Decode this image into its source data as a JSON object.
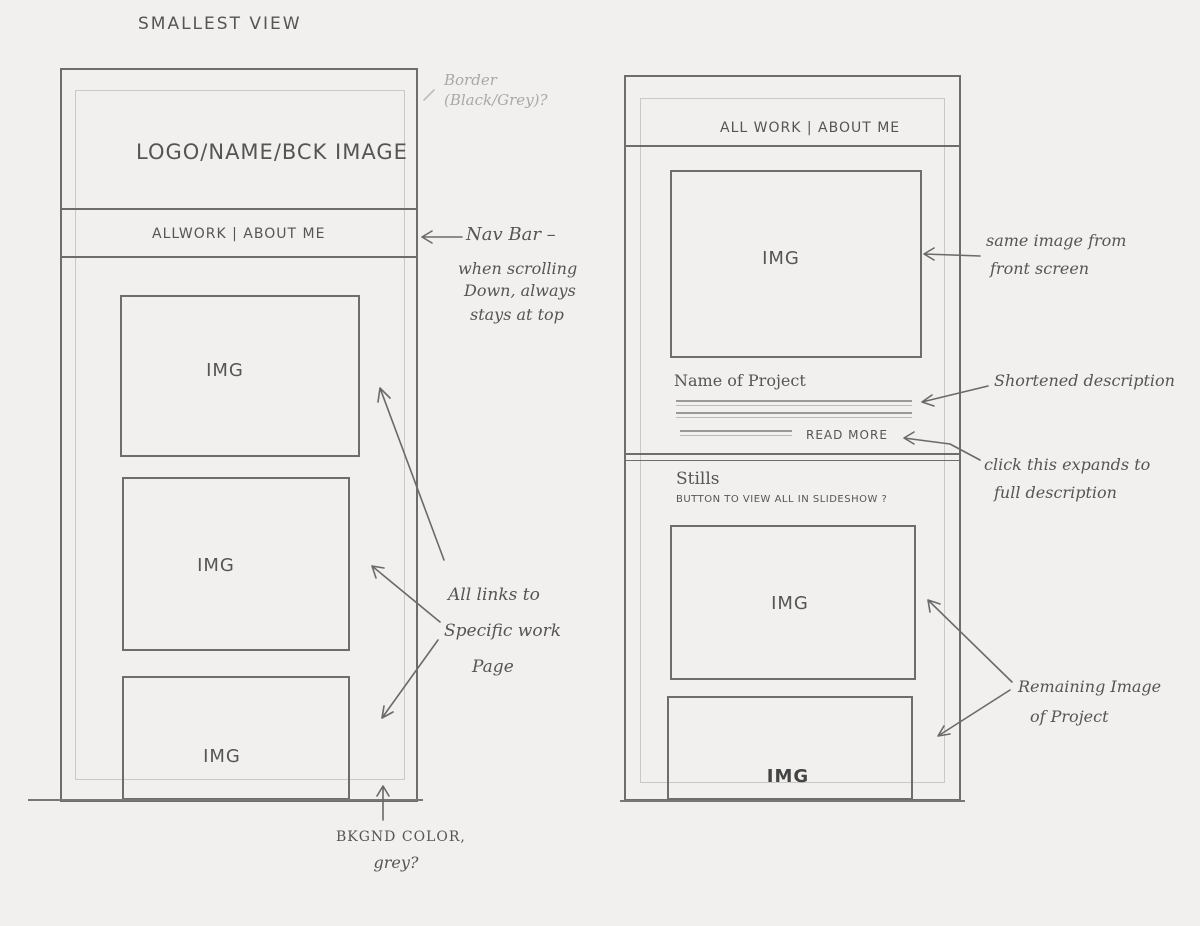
{
  "title": "SMALLEST VIEW",
  "left_mockup": {
    "header": "LOGO/NAME/BCK IMAGE",
    "nav": "ALLWORK | ABOUT ME",
    "images": [
      "IMG",
      "IMG",
      "IMG"
    ]
  },
  "right_mockup": {
    "nav": "ALL WORK | ABOUT ME",
    "hero_image": "IMG",
    "project_name": "Name of Project",
    "read_more": "READ MORE",
    "stills_title": "Stills",
    "stills_note": "BUTTON TO VIEW ALL IN SLIDESHOW ?",
    "images": [
      "IMG",
      "IMG"
    ]
  },
  "annotations": {
    "border": "Border (Black/Grey)?",
    "navbar": [
      "Nav Bar –",
      "when scrolling",
      "Down, always",
      "stays at top"
    ],
    "links": [
      "All links to",
      "Specific work",
      "Page"
    ],
    "bkgnd": [
      "BKGND COLOR,",
      "grey?"
    ],
    "same_image": [
      "same image from",
      "front screen"
    ],
    "shortened": "Shortened description",
    "click_expands": [
      "click this expands to",
      "full description"
    ],
    "remaining": [
      "Remaining Image",
      "of Project"
    ]
  }
}
